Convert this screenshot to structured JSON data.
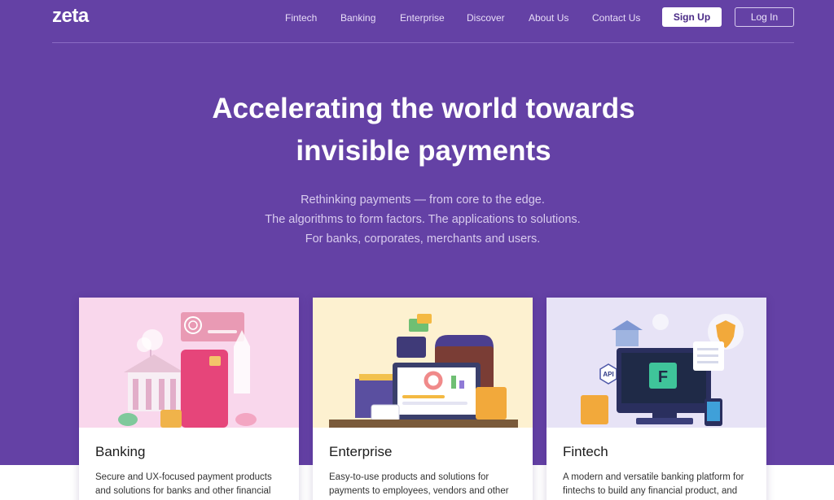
{
  "brand": {
    "logo_text": "zeta"
  },
  "nav": {
    "links": [
      "Fintech",
      "Banking",
      "Enterprise",
      "Discover",
      "About Us",
      "Contact Us"
    ],
    "signup_label": "Sign Up",
    "login_label": "Log In"
  },
  "hero": {
    "title_line1": "Accelerating the world towards",
    "title_line2": "invisible payments",
    "sub_line1": "Rethinking payments — from core to the edge.",
    "sub_line2": "The algorithms to form factors. The applications to solutions.",
    "sub_line3": "For banks, corporates, merchants and users."
  },
  "cards": [
    {
      "title": "Banking",
      "desc_line1": "Secure and UX-focused payment products",
      "desc_line2": "and solutions for banks and other financial"
    },
    {
      "title": "Enterprise",
      "desc_line1": "Easy-to-use products and solutions for",
      "desc_line2": "payments to employees, vendors and other"
    },
    {
      "title": "Fintech",
      "desc_line1": "A modern and versatile banking platform for",
      "desc_line2": "fintechs to build any financial product, and"
    }
  ],
  "illustration_labels": {
    "api": "API",
    "fintech_letter": "F"
  },
  "colors": {
    "hero_bg": "#6441a5",
    "card_banking_bg": "#f9d7ec",
    "card_enterprise_bg": "#fdf1d0",
    "card_fintech_bg": "#e7e3f6"
  }
}
